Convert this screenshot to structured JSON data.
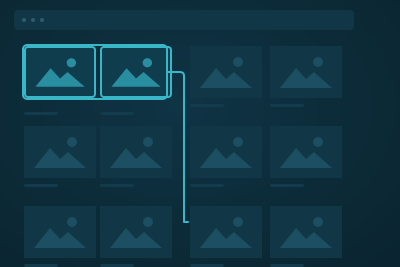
{
  "theme": {
    "background": "#0c2a37",
    "tile": "#113747",
    "icon": "#1b4f61",
    "icon_selected": "#2a8ea1",
    "accent": "#39b6c8"
  },
  "window": {
    "titlebar_dots": [
      "window-dot-1",
      "window-dot-2",
      "window-dot-3"
    ]
  },
  "gallery": {
    "selected_count": 2,
    "tiles": [
      {
        "row": 0,
        "col": 0,
        "selected": true,
        "icon": "image-placeholder-icon"
      },
      {
        "row": 0,
        "col": 1,
        "selected": true,
        "icon": "image-placeholder-icon"
      },
      {
        "row": 0,
        "col": 2,
        "selected": false,
        "icon": "image-placeholder-icon"
      },
      {
        "row": 0,
        "col": 3,
        "selected": false,
        "icon": "image-placeholder-icon"
      },
      {
        "row": 1,
        "col": 0,
        "selected": false,
        "icon": "image-placeholder-icon"
      },
      {
        "row": 1,
        "col": 1,
        "selected": false,
        "icon": "image-placeholder-icon"
      },
      {
        "row": 1,
        "col": 2,
        "selected": false,
        "icon": "image-placeholder-icon"
      },
      {
        "row": 1,
        "col": 3,
        "selected": false,
        "icon": "image-placeholder-icon"
      },
      {
        "row": 2,
        "col": 0,
        "selected": false,
        "icon": "image-placeholder-icon"
      },
      {
        "row": 2,
        "col": 1,
        "selected": false,
        "icon": "image-placeholder-icon"
      },
      {
        "row": 2,
        "col": 2,
        "selected": false,
        "icon": "image-placeholder-icon"
      },
      {
        "row": 2,
        "col": 3,
        "selected": false,
        "icon": "image-placeholder-icon"
      }
    ]
  },
  "drag": {
    "icon": "drag-path-icon",
    "target": "row-3-col-3"
  }
}
